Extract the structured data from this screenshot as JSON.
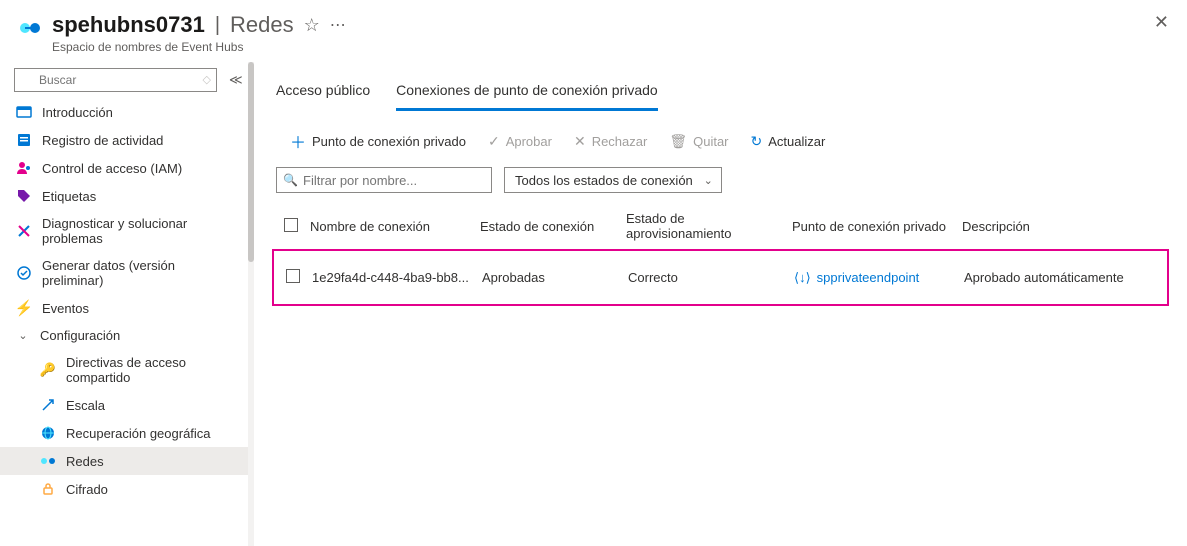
{
  "header": {
    "title": "spehubns0731",
    "section": "Redes",
    "subtitle": "Espacio de nombres de Event Hubs"
  },
  "sidebar": {
    "search_placeholder": "Buscar",
    "items": {
      "overview": "Introducción",
      "activity": "Registro de actividad",
      "iam": "Control de acceso (IAM)",
      "tags": "Etiquetas",
      "diag": "Diagnosticar y solucionar problemas",
      "gendata": "Generar datos (versión preliminar)",
      "events": "Eventos",
      "config": "Configuración",
      "shared": "Directivas de acceso compartido",
      "scale": "Escala",
      "geo": "Recuperación geográfica",
      "network": "Redes",
      "encrypt": "Cifrado"
    }
  },
  "tabs": {
    "public": "Acceso público",
    "private": "Conexiones de punto de conexión privado"
  },
  "toolbar": {
    "add": "Punto de conexión privado",
    "approve": "Aprobar",
    "reject": "Rechazar",
    "remove": "Quitar",
    "refresh": "Actualizar"
  },
  "filter": {
    "placeholder": "Filtrar por nombre...",
    "state_all": "Todos los estados de conexión"
  },
  "table": {
    "cols": {
      "name": "Nombre de conexión",
      "state": "Estado de conexión",
      "prov": "Estado de aprovisionamiento",
      "pe": "Punto de conexión privado",
      "desc": "Descripción"
    },
    "rows": [
      {
        "name": "1e29fa4d-c448-4ba9-bb8...",
        "state": "Aprobadas",
        "prov": "Correcto",
        "pe": "spprivateendpoint",
        "desc": "Aprobado automáticamente"
      }
    ]
  }
}
